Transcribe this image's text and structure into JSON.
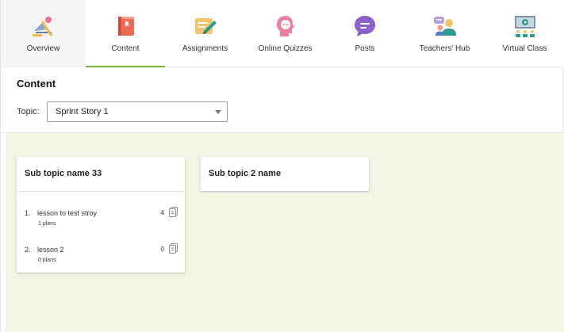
{
  "tabs": [
    {
      "key": "overview",
      "label": "Overview",
      "icon": "overview-icon"
    },
    {
      "key": "content",
      "label": "Content",
      "icon": "book-icon",
      "selected": true
    },
    {
      "key": "assignments",
      "label": "Assignments",
      "icon": "assignment-pen-icon"
    },
    {
      "key": "quizzes",
      "label": "Online Quizzes",
      "icon": "quiz-head-icon"
    },
    {
      "key": "posts",
      "label": "Posts",
      "icon": "chat-bubble-icon"
    },
    {
      "key": "teachers",
      "label": "Teachers' Hub",
      "icon": "teachers-group-icon"
    },
    {
      "key": "virtual",
      "label": "Virtual Class",
      "icon": "virtual-class-icon"
    }
  ],
  "accent_color": "#7cb342",
  "content": {
    "title": "Content",
    "topic_label": "Topic:",
    "topic_value": "Sprint Story 1"
  },
  "cards": [
    {
      "title": "Sub topic name 33",
      "lessons": [
        {
          "index": "1.",
          "name": "lesson to test stroy",
          "plans": "1 plans",
          "count": "4"
        },
        {
          "index": "2.",
          "name": "lesson 2",
          "plans": "0 plans",
          "count": "0"
        }
      ]
    },
    {
      "title": "Sub topic 2 name",
      "lessons": []
    }
  ]
}
